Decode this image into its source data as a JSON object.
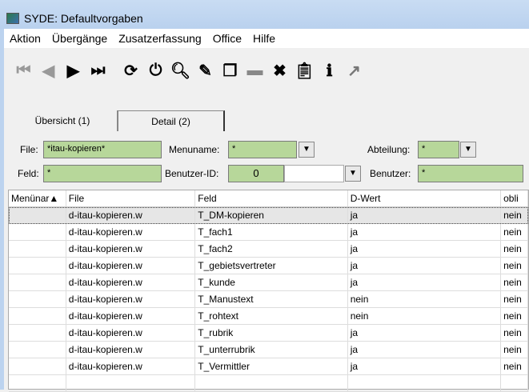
{
  "window": {
    "title": "SYDE: Defaultvorgaben"
  },
  "menu": [
    "Aktion",
    "Übergänge",
    "Zusatzerfassung",
    "Office",
    "Hilfe"
  ],
  "toolbar": [
    {
      "icon": "first-record-icon",
      "glyph": "⏮",
      "color": "#999"
    },
    {
      "icon": "previous-record-icon",
      "glyph": "◀",
      "color": "#999"
    },
    {
      "icon": "next-record-icon",
      "glyph": "▶",
      "color": "#000"
    },
    {
      "icon": "last-record-icon",
      "glyph": "⏭",
      "color": "#000"
    },
    {
      "icon": "refresh-icon",
      "glyph": "⟳",
      "color": "#000"
    },
    {
      "icon": "power-icon",
      "glyph": "⏻",
      "color": "#000"
    },
    {
      "icon": "search-icon",
      "glyph": "🔍︎",
      "color": "#000"
    },
    {
      "icon": "edit-icon",
      "glyph": "✎",
      "color": "#000"
    },
    {
      "icon": "copy-icon",
      "glyph": "❐",
      "color": "#000"
    },
    {
      "icon": "stamp-icon",
      "glyph": "▬",
      "color": "#888"
    },
    {
      "icon": "delete-icon",
      "glyph": "✖",
      "color": "#000"
    },
    {
      "icon": "clipboard-icon",
      "glyph": "📋︎",
      "color": "#000"
    },
    {
      "icon": "info-icon",
      "glyph": "ℹ",
      "color": "#000"
    },
    {
      "icon": "export-icon",
      "glyph": "↗",
      "color": "#777"
    }
  ],
  "tabs": [
    "Übersicht (1)",
    "Detail (2)"
  ],
  "filters": {
    "file_label": "File:",
    "file_value": "*itau-kopieren*",
    "menuname_label": "Menuname:",
    "menuname_value": "*",
    "abteilung_label": "Abteilung:",
    "abteilung_value": "*",
    "feld_label": "Feld:",
    "feld_value": "*",
    "benutzerid_label": "Benutzer-ID:",
    "benutzerid_value": "0",
    "benutzer_label": "Benutzer:",
    "benutzer_value": "*"
  },
  "table": {
    "headers": [
      "Menünar▲",
      "File",
      "Feld",
      "D-Wert",
      "obli"
    ],
    "rows": [
      [
        "",
        "d-itau-kopieren.w",
        "T_DM-kopieren",
        "ja",
        "nein"
      ],
      [
        "",
        "d-itau-kopieren.w",
        "T_fach1",
        "ja",
        "nein"
      ],
      [
        "",
        "d-itau-kopieren.w",
        "T_fach2",
        "ja",
        "nein"
      ],
      [
        "",
        "d-itau-kopieren.w",
        "T_gebietsvertreter",
        "ja",
        "nein"
      ],
      [
        "",
        "d-itau-kopieren.w",
        "T_kunde",
        "ja",
        "nein"
      ],
      [
        "",
        "d-itau-kopieren.w",
        "T_Manustext",
        "nein",
        "nein"
      ],
      [
        "",
        "d-itau-kopieren.w",
        "T_rohtext",
        "nein",
        "nein"
      ],
      [
        "",
        "d-itau-kopieren.w",
        "T_rubrik",
        "ja",
        "nein"
      ],
      [
        "",
        "d-itau-kopieren.w",
        "T_unterrubrik",
        "ja",
        "nein"
      ],
      [
        "",
        "d-itau-kopieren.w",
        "T_Vermittler",
        "ja",
        "nein"
      ]
    ]
  }
}
